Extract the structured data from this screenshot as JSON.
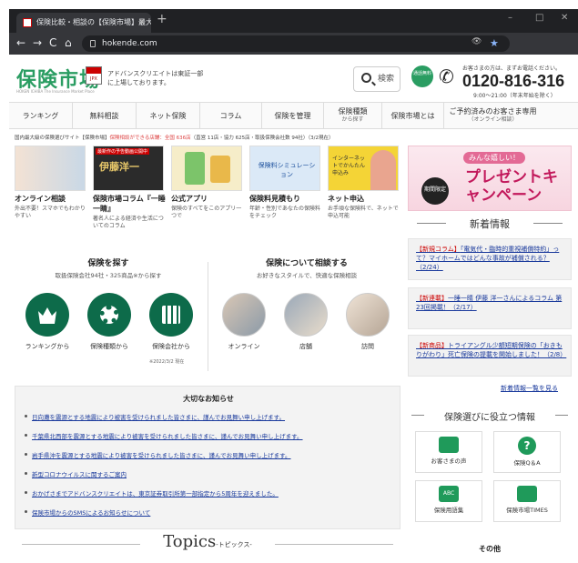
{
  "browser": {
    "tab_title": "保険比較・相談の【保険市場】最大",
    "url": "hokende.com",
    "new_tab": "+",
    "close": "✕",
    "win_min": "–",
    "win_max": "□",
    "win_close": "✕",
    "back": "←",
    "fwd": "→",
    "reload": "C",
    "home": "⌂",
    "star": "★",
    "eye": "👁"
  },
  "header": {
    "logo": "保険市場",
    "logo_sub": "HOKEN ICHIBA  The Insurance Market Place",
    "jpx": "JPX",
    "corp": "アドバンスクリエイトは東証一部に上場しております。",
    "search_label": "検索",
    "free_label": "通話無料",
    "tel_note": "お客さまの方は、まずお電話ください。",
    "tel": "0120-816-316",
    "hours": "9:00〜21:00（年末年始を除く）"
  },
  "nav": [
    {
      "label": "ランキング"
    },
    {
      "label": "無料相談"
    },
    {
      "label": "ネット保険"
    },
    {
      "label": "コラム"
    },
    {
      "label": "保険を管理"
    },
    {
      "label": "保険種類",
      "sub": "から探す"
    },
    {
      "label": "保険市場とは"
    },
    {
      "label": "ご予約済みのお客さま専用",
      "sub": "（オンライン相談）"
    }
  ],
  "notice": {
    "prefix": "国内最大級の保険選びサイト【保険市場】",
    "em": "保険相談ができる店舗：全国 636店",
    "rest": "（直営 11店・協力 625店・取扱保険会社数 94社）（3/2現在）"
  },
  "cards": [
    {
      "title": "オンライン相談",
      "desc": "外出不要！スマホでもわかりやすい"
    },
    {
      "title": "保険市場コラム『一睡一睛』",
      "desc": "著名人による経済や生活についてのコラム",
      "img_text": "伊藤洋一",
      "badge": "最新作の予告動画公開中"
    },
    {
      "title": "公式アプリ",
      "desc": "保険のすべてをこのアプリ一つで"
    },
    {
      "title": "保険料見積もり",
      "desc": "年齢・性別であなたの保険料をチェック",
      "img_text": "保険料シミュレーション"
    },
    {
      "title": "ネット申込",
      "desc": "お手頃な保険料で、ネットで申込可能",
      "img_text": "インターネットでかんたん申込み"
    }
  ],
  "campaign": {
    "tag1": "みんな嬉しい！",
    "main": "プレゼントキャンペーン",
    "badge": "期間限定"
  },
  "news": {
    "heading": "新着情報",
    "items": [
      {
        "tag": "【新規コラム】",
        "text": "「電気代・臨時的重視補償特約」って？マイホームではどんな事故が補償される？（2/24）"
      },
      {
        "tag": "【新連載】",
        "text": "一睡一睛 伊藤 洋一さんによるコラム 第23回掲載！（2/17）"
      },
      {
        "tag": "【新商品】",
        "text": "トライアングル少額短期保険の「おきもりがわり」死亡保険の提載を開始しました！（2/8）"
      }
    ],
    "more": "新着情報一覧を見る"
  },
  "find": {
    "title": "保険を探す",
    "sub": "取扱保険会社94社・325商品※から探す",
    "items": [
      "ランキングから",
      "保険種類から",
      "保険会社から"
    ],
    "note": "※2022/3/2 現在"
  },
  "consult": {
    "title": "保険について相談する",
    "sub": "お好きなスタイルで、快適な保険相談",
    "items": [
      "オンライン",
      "店舗",
      "訪問"
    ]
  },
  "important": {
    "title": "大切なお知らせ",
    "items": [
      "日向灘を震源とする地震により被害を受けられました皆さまに、謹んでお見舞い申し上げます。",
      "千葉県北西部を震源とする地震により被害を受けられました皆さまに、謹んでお見舞い申し上げます。",
      "岩手県沖を震源とする地震により被害を受けられました皆さまに、謹んでお見舞い申し上げます。",
      "新型コロナウイルスに関するご案内",
      "おかげさまでアドバンスクリエイトは、東京証券取引所第一部指定から5周年を迎えました。",
      "保険市場からのSMSによるお知らせについて"
    ]
  },
  "topics": {
    "main": "Topics",
    "sub": "-トピックス-"
  },
  "useful": {
    "heading": "保険選びに役立つ情報",
    "tiles": [
      "お客さまの声",
      "保険Q＆A",
      "保険用語集",
      "保険市場TIMES"
    ],
    "other": "その他",
    "q_mark": "?",
    "abc": "ABC"
  }
}
